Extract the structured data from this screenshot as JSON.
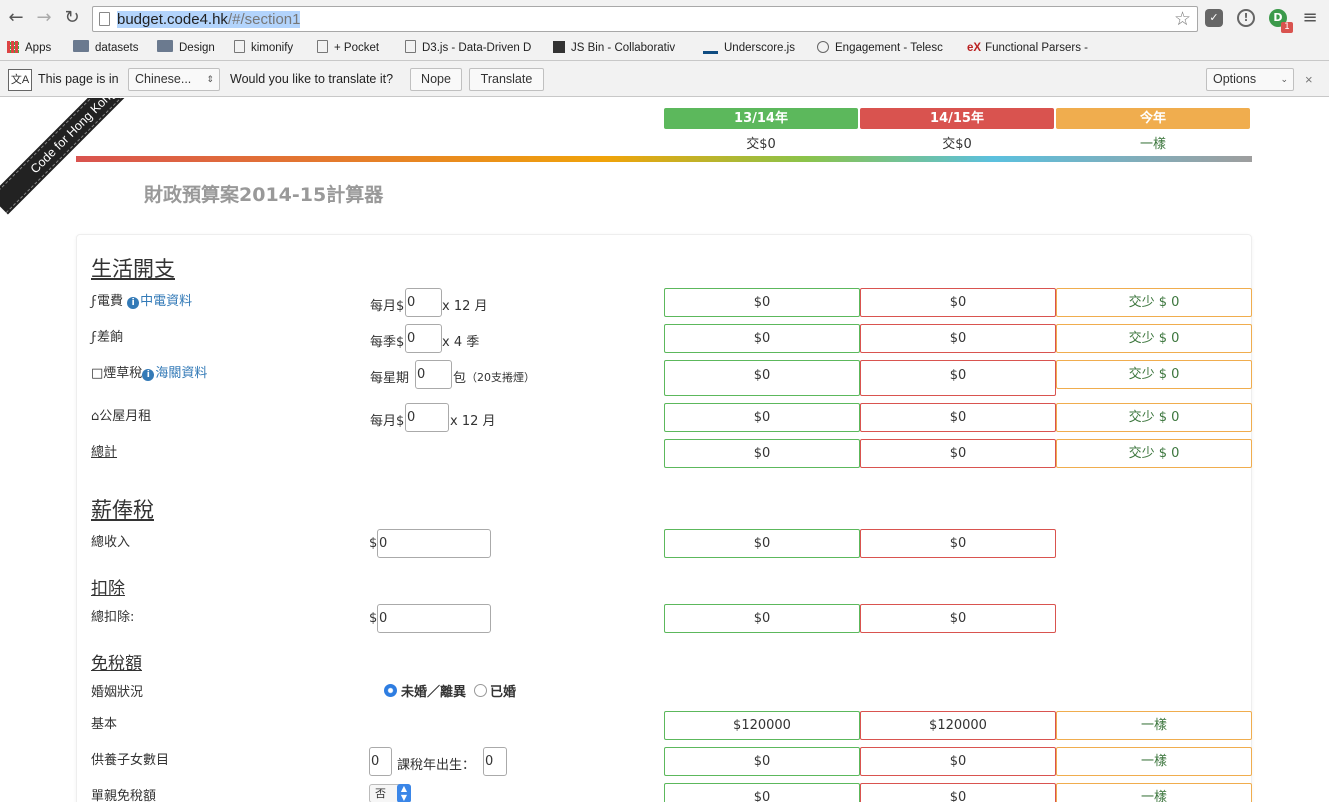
{
  "browser": {
    "url_host": "budget.code4.hk",
    "url_path": "/#/section1",
    "ext_badge": "1",
    "bookmarks": [
      "Apps",
      "datasets",
      "Design",
      "kimonify",
      "+ Pocket",
      "D3.js - Data-Driven D",
      "JS Bin - Collaborativ",
      "Underscore.js",
      "Engagement - Telesc",
      "Functional Parsers -"
    ],
    "translate": {
      "prefix": "This page is in",
      "language": "Chinese...",
      "question": "Would you like to translate it?",
      "nope": "Nope",
      "translate": "Translate",
      "options": "Options"
    }
  },
  "ribbon": "Code for Hong Kong",
  "columns": [
    {
      "title": "13/14年",
      "sub": "交$0",
      "color": "#5cb85c"
    },
    {
      "title": "14/15年",
      "sub": "交$0",
      "color": "#d9534f"
    },
    {
      "title": "今年",
      "sub": "一樣",
      "color": "#f0ad4e"
    }
  ],
  "app_title": "財政預算案2014-15計算器",
  "living": {
    "heading": "生活開支",
    "rows": [
      {
        "label": "電費",
        "link": "中電資料",
        "prefix": "每月$",
        "value": "0",
        "suffix": "x 12 月",
        "c1": "$0",
        "c2": "$0",
        "c3": "交少 $ 0"
      },
      {
        "label": "差餉",
        "prefix": "每季$",
        "value": "0",
        "suffix": "x 4 季",
        "c1": "$0",
        "c2": "$0",
        "c3": "交少 $ 0"
      },
      {
        "label": "煙草稅",
        "link": "海關資料",
        "prefix": "每星期",
        "value": "0",
        "suffix": "包",
        "note": "（20支捲煙）",
        "c1": "$0",
        "c2": "$0",
        "c3": "交少 $ 0"
      },
      {
        "label": "公屋月租",
        "prefix": "每月$",
        "value": "0",
        "suffix": "x 12 月",
        "c1": "$0",
        "c2": "$0",
        "c3": "交少 $ 0"
      }
    ],
    "total": {
      "label": "總計",
      "c1": "$0",
      "c2": "$0",
      "c3": "交少 $ 0"
    }
  },
  "salary": {
    "heading": "薪俸稅",
    "income": {
      "label": "總收入",
      "prefix": "$",
      "value": "0",
      "c1": "$0",
      "c2": "$0"
    },
    "deduct_heading": "扣除",
    "deduct": {
      "label": "總扣除:",
      "prefix": "$",
      "value": "0",
      "c1": "$0",
      "c2": "$0"
    },
    "allow_heading": "免稅額",
    "marital": {
      "label": "婚姻狀況",
      "opt1": "未婚／離異",
      "opt2": "已婚"
    },
    "basic": {
      "label": "基本",
      "c1": "$120000",
      "c2": "$120000",
      "c3": "一樣"
    },
    "children": {
      "label": "供養子女數目",
      "value": "0",
      "born_label": "課稅年出生：",
      "born_value": "0",
      "c1": "$0",
      "c2": "$0",
      "c3": "一樣"
    },
    "single_parent": {
      "label": "單親免稅額",
      "select": "否",
      "c1": "$0",
      "c2": "$0",
      "c3": "一樣"
    }
  }
}
